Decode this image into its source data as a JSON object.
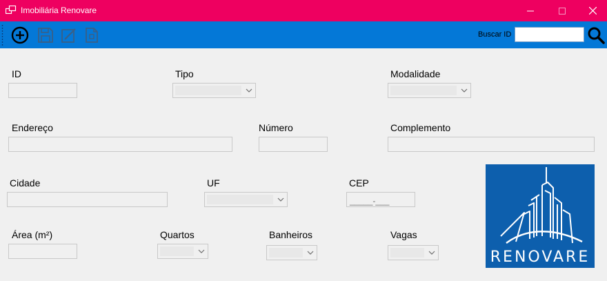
{
  "window": {
    "title": "Imobiliária Renovare",
    "icons": [
      "app-icon",
      "minimize-icon",
      "maximize-icon",
      "close-icon"
    ]
  },
  "toolbar": {
    "buttons": [
      "add-icon",
      "save-icon",
      "edit-icon",
      "document-icon"
    ],
    "search_label": "Buscar ID",
    "search_value": "",
    "search_button_icon": "magnifier-icon"
  },
  "form": {
    "id_label": "ID",
    "tipo_label": "Tipo",
    "modalidade_label": "Modalidade",
    "endereco_label": "Endereço",
    "numero_label": "Número",
    "complemento_label": "Complemento",
    "cidade_label": "Cidade",
    "uf_label": "UF",
    "cep_label": "CEP",
    "cep_mask": "_____-___",
    "area_label": "Área (m²)",
    "quartos_label": "Quartos",
    "banheiros_label": "Banheiros",
    "vagas_label": "Vagas"
  },
  "logo": {
    "text": "RENOVARE",
    "background": "#0d5fad"
  },
  "colors": {
    "titlebar": "#ee0060",
    "toolbar": "#0478d7",
    "window_bg": "#f0f0f0"
  }
}
